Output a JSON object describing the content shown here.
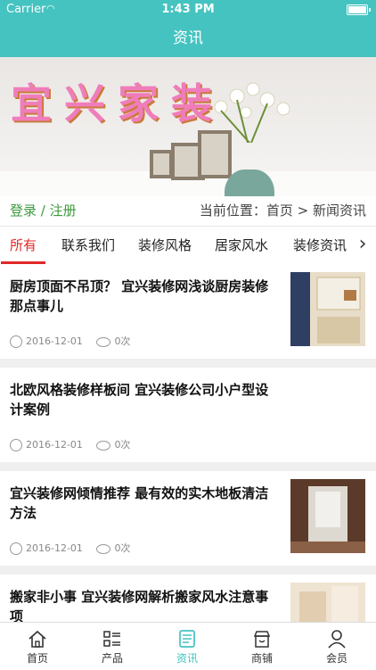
{
  "status": {
    "carrier": "Carrier",
    "time": "1:43 PM"
  },
  "header": {
    "title": "资讯"
  },
  "banner": {
    "text": "宜兴家装"
  },
  "account": {
    "login": "登录",
    "sep": "/",
    "register": "注册",
    "location": "当前位置：首页 > 新闻资讯"
  },
  "tabs": [
    "所有",
    "联系我们",
    "装修风格",
    "居家风水",
    "装修资讯"
  ],
  "articles": [
    {
      "title": "厨房顶面不吊顶？ 宜兴装修网浅谈厨房装修那点事儿",
      "date": "2016-12-01",
      "views": "0次"
    },
    {
      "title": "北欧风格装修样板间 宜兴装修公司小户型设计案例",
      "date": "2016-12-01",
      "views": "0次"
    },
    {
      "title": "宜兴装修网倾情推荐 最有效的实木地板清洁方法",
      "date": "2016-12-01",
      "views": "0次"
    },
    {
      "title": "搬家非小事 宜兴装修网解析搬家风水注意事项",
      "date": "",
      "views": ""
    }
  ],
  "tabbar": [
    {
      "label": "首页",
      "icon": "home-icon"
    },
    {
      "label": "产品",
      "icon": "list-icon"
    },
    {
      "label": "资讯",
      "icon": "news-icon"
    },
    {
      "label": "商铺",
      "icon": "shop-icon"
    },
    {
      "label": "会员",
      "icon": "user-icon"
    }
  ],
  "colors": {
    "accent": "#45c3c0",
    "active_tab": "#e02828",
    "login": "#3c9a3c"
  }
}
